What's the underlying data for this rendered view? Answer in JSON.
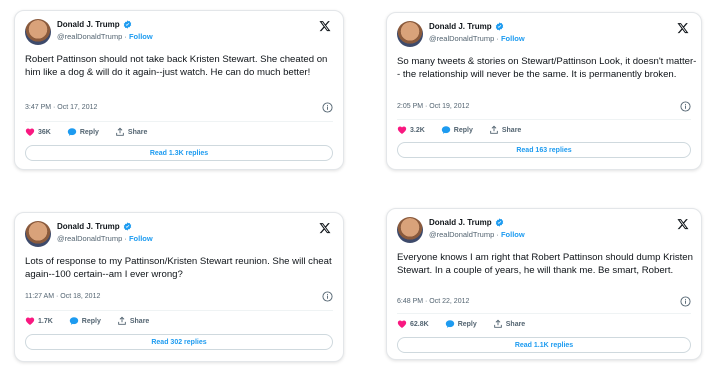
{
  "author": {
    "name": "Donald J. Trump",
    "handle": "@realDonaldTrump",
    "separator": "·",
    "follow_label": "Follow"
  },
  "tweets": [
    {
      "text": "Robert Pattinson should not take back Kristen Stewart. She cheated on him like a dog & will do it again--just watch. He can do much better!",
      "timestamp": "3:47 PM · Oct 17, 2012",
      "likes": "36K",
      "reply_label": "Reply",
      "share_label": "Share",
      "read_replies": "Read 1.3K replies"
    },
    {
      "text": "So many tweets & stories on Stewart/Pattinson Look, it doesn't matter-- the relationship will never be the same. It is permanently broken.",
      "timestamp": "2:05 PM · Oct 19, 2012",
      "likes": "3.2K",
      "reply_label": "Reply",
      "share_label": "Share",
      "read_replies": "Read 163 replies"
    },
    {
      "text": "Lots of response to my Pattinson/Kristen Stewart reunion. She will cheat again--100 certain--am I ever wrong?",
      "timestamp": "11:27 AM · Oct 18, 2012",
      "likes": "1.7K",
      "reply_label": "Reply",
      "share_label": "Share",
      "read_replies": "Read 302 replies"
    },
    {
      "text": "Everyone knows I am right that Robert Pattinson should dump Kristen Stewart. In a couple of years, he will thank me. Be smart, Robert.",
      "timestamp": "6:48 PM · Oct 22, 2012",
      "likes": "62.8K",
      "reply_label": "Reply",
      "share_label": "Share",
      "read_replies": "Read 1.1K replies"
    }
  ],
  "colors": {
    "heart": "#f91880",
    "link": "#1d9bf0",
    "muted": "#536471",
    "verified": "#1d9bf0"
  },
  "icons": [
    "verified-badge-icon",
    "x-logo-icon",
    "info-icon",
    "heart-icon",
    "reply-bubble-icon",
    "share-upload-icon"
  ]
}
